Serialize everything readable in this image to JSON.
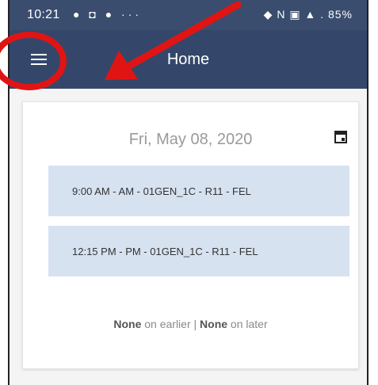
{
  "status_bar": {
    "time": "10:21",
    "left_icons": "● ◘ ● ···",
    "right_icons": "◆ N ▣ ▲ .",
    "battery": "85%"
  },
  "app_bar": {
    "title": "Home",
    "menu_icon": "hamburger-menu-icon"
  },
  "card": {
    "date": "Fri, May 08, 2020",
    "calendar_icon": "calendar-icon",
    "events": [
      {
        "label": "9:00 AM - AM - 01GEN_1C - R11 - FEL"
      },
      {
        "label": "12:15 PM - PM - 01GEN_1C - R11 - FEL"
      }
    ],
    "footer": {
      "earlier_count": "None",
      "earlier_text": " on earlier | ",
      "later_count": "None",
      "later_text": " on later"
    }
  },
  "annotation": {
    "color": "#e11414"
  }
}
